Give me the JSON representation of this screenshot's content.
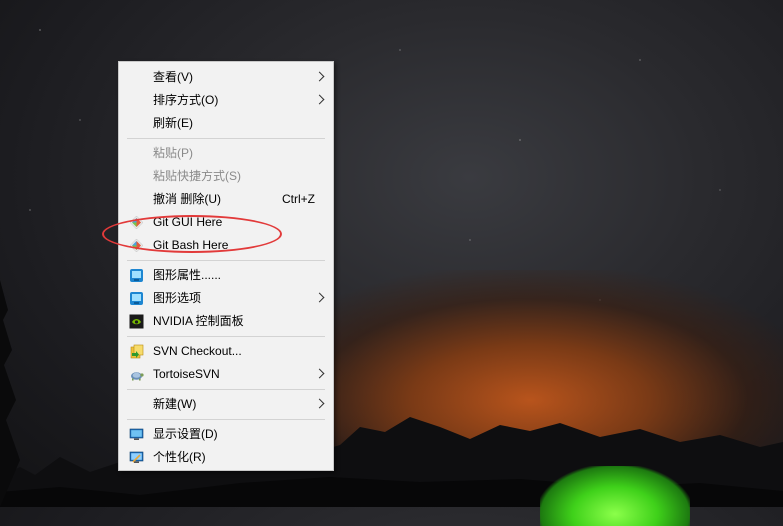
{
  "menu": {
    "view": "查看(V)",
    "sort": "排序方式(O)",
    "refresh": "刷新(E)",
    "paste": "粘贴(P)",
    "paste_shortcut": "粘贴快捷方式(S)",
    "undo_delete": "撤消 删除(U)",
    "undo_shortcut": "Ctrl+Z",
    "git_gui": "Git GUI Here",
    "git_bash": "Git Bash Here",
    "graphics_properties": "图形属性......",
    "graphics_options": "图形选项",
    "nvidia_panel": "NVIDIA 控制面板",
    "svn_checkout": "SVN Checkout...",
    "tortoise_svn": "TortoiseSVN",
    "new": "新建(W)",
    "display_settings": "显示设置(D)",
    "personalize": "个性化(R)"
  },
  "icons": {
    "git": "git-diamond-icon",
    "intel_graphics": "intel-graphics-icon",
    "nvidia": "nvidia-icon",
    "svn_checkout": "svn-checkout-icon",
    "tortoise": "tortoise-svn-icon",
    "display": "display-monitor-icon",
    "personalize": "personalize-icon"
  },
  "colors": {
    "highlight_ellipse": "#e23a3a",
    "menu_bg": "#f2f2f2",
    "disabled_text": "#8a8a8a"
  }
}
